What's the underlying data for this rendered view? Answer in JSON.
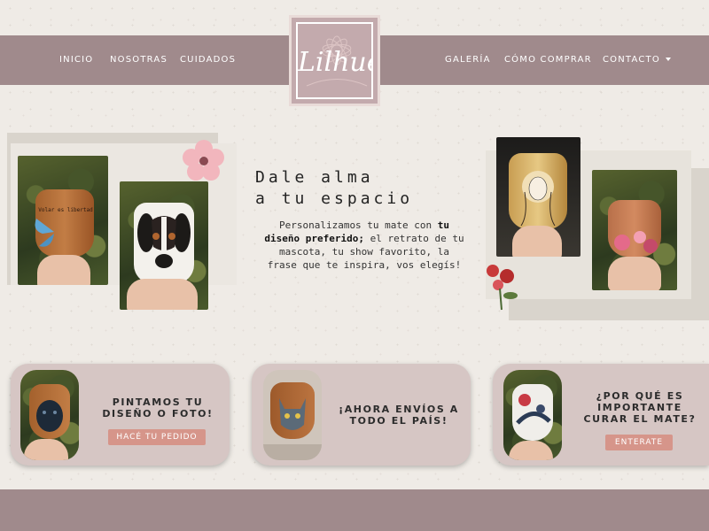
{
  "brand": {
    "logo_text": "Lilhué"
  },
  "nav": {
    "left": [
      "INICIO",
      "NOSOTRAS",
      "CUIDADOS"
    ],
    "right": [
      "GALERÍA",
      "CÓMO COMPRAR",
      "CONTACTO"
    ]
  },
  "hero": {
    "title": "Dale alma\na tu espacio",
    "text_pre": "Personalizamos tu mate con ",
    "text_bold": "tu diseño preferido;",
    "text_post": " el retrato de tu mascota, tu show favorito, la frase que te inspira, vos elegís!",
    "left_cup_text": "Volar es libertad"
  },
  "cards": [
    {
      "title": "PINTAMOS TU\nDISEÑO O FOTO!",
      "button": "HACÉ TU PEDIDO"
    },
    {
      "title": "¡AHORA ENVÍOS A\nTODO EL PAÍS!"
    },
    {
      "title": "¿POR QUÉ ES\nIMPORTANTE\nCURAR EL MATE?",
      "button": "ENTERATE"
    }
  ],
  "colors": {
    "nav_bg": "#a08a8c",
    "card_bg": "#d6c6c4",
    "button_bg": "#d6958a",
    "page_bg": "#efebe6"
  }
}
